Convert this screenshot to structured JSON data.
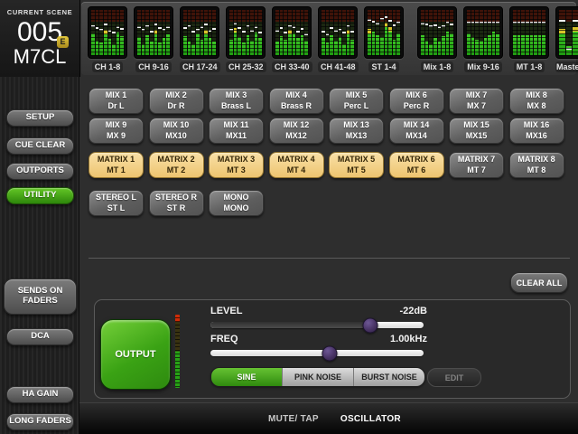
{
  "scene": {
    "label": "CURRENT SCENE",
    "number": "005",
    "badge": "E",
    "name": "M7CL"
  },
  "meter_bridge": {
    "blocks": [
      {
        "label": "CH 1-8",
        "levels": [
          48,
          32,
          28,
          56,
          36,
          24,
          50,
          42
        ],
        "peaks": [
          62,
          58,
          55,
          66,
          52,
          48,
          60,
          57
        ]
      },
      {
        "label": "CH 9-16",
        "levels": [
          40,
          25,
          45,
          30,
          57,
          28,
          38,
          46
        ],
        "peaks": [
          60,
          55,
          63,
          50,
          66,
          58,
          54,
          61
        ]
      },
      {
        "label": "CH 17-24",
        "levels": [
          42,
          30,
          25,
          48,
          35,
          56,
          38,
          30
        ],
        "peaks": [
          58,
          62,
          50,
          55,
          60,
          66,
          52,
          57
        ]
      },
      {
        "label": "CH 25-32",
        "levels": [
          35,
          60,
          40,
          28,
          45,
          32,
          50,
          38
        ],
        "peaks": [
          55,
          68,
          58,
          50,
          62,
          52,
          60,
          48
        ]
      },
      {
        "label": "CH 33-40",
        "levels": [
          30,
          42,
          35,
          56,
          48,
          38,
          44,
          32
        ],
        "peaks": [
          52,
          58,
          48,
          62,
          60,
          50,
          56,
          45
        ]
      },
      {
        "label": "CH 41-48",
        "levels": [
          38,
          28,
          45,
          33,
          40,
          25,
          56,
          35
        ],
        "peaks": [
          50,
          45,
          58,
          52,
          55,
          48,
          63,
          50
        ]
      },
      {
        "label": "ST 1-4",
        "levels": [
          58,
          52,
          45,
          40,
          72,
          62,
          35,
          48
        ],
        "peaks": [
          76,
          72,
          68,
          78,
          82,
          74,
          65,
          70
        ]
      },
      {
        "label": "Mix 1-8",
        "levels": [
          45,
          32,
          25,
          38,
          30,
          42,
          52,
          48
        ],
        "peaks": [
          68,
          66,
          62,
          64,
          60,
          63,
          71,
          67
        ],
        "gap_before": true
      },
      {
        "label": "Mix 9-16",
        "levels": [
          48,
          40,
          35,
          32,
          38,
          44,
          52,
          46
        ],
        "peaks": [
          71,
          71,
          71,
          71,
          71,
          71,
          71,
          71
        ]
      },
      {
        "label": "MT 1-8",
        "levels": [
          45,
          45,
          44,
          45,
          45,
          44,
          45,
          45
        ],
        "peaks": [
          71,
          71,
          71,
          71,
          71,
          71,
          71,
          71
        ]
      },
      {
        "label": "Master",
        "levels": [
          58,
          20,
          62
        ],
        "peaks": [
          74,
          12,
          74
        ],
        "narrow": true
      }
    ]
  },
  "sidebar": {
    "buttons": [
      {
        "id": "setup",
        "lines": [
          "SETUP"
        ],
        "variant": "gray"
      },
      {
        "id": "cue-clear",
        "lines": [
          "CUE CLEAR"
        ],
        "variant": "gray"
      },
      {
        "id": "outports",
        "lines": [
          "OUTPORTS"
        ],
        "variant": "gray"
      },
      {
        "id": "utility",
        "lines": [
          "UTILITY"
        ],
        "variant": "green"
      },
      {
        "id": "sends-on-faders",
        "lines": [
          "SENDS ON",
          "FADERS"
        ],
        "variant": "gray"
      },
      {
        "id": "dca",
        "lines": [
          "DCA"
        ],
        "variant": "gray"
      },
      {
        "id": "ha-gain",
        "lines": [
          "HA GAIN"
        ],
        "variant": "gray"
      },
      {
        "id": "long-faders",
        "lines": [
          "LONG FADERS"
        ],
        "variant": "gray"
      }
    ]
  },
  "bus_grid": {
    "rows": [
      {
        "buttons": [
          {
            "line1": "MIX 1",
            "line2": "Dr L",
            "active": false
          },
          {
            "line1": "MIX 2",
            "line2": "Dr R",
            "active": false
          },
          {
            "line1": "MIX 3",
            "line2": "Brass L",
            "active": false
          },
          {
            "line1": "MIX 4",
            "line2": "Brass R",
            "active": false
          },
          {
            "line1": "MIX 5",
            "line2": "Perc L",
            "active": false
          },
          {
            "line1": "MIX 6",
            "line2": "Perc R",
            "active": false
          },
          {
            "line1": "MIX 7",
            "line2": "MX 7",
            "active": false
          },
          {
            "line1": "MIX 8",
            "line2": "MX 8",
            "active": false
          }
        ]
      },
      {
        "buttons": [
          {
            "line1": "MIX 9",
            "line2": "MX 9",
            "active": false
          },
          {
            "line1": "MIX 10",
            "line2": "MX10",
            "active": false
          },
          {
            "line1": "MIX 11",
            "line2": "MX11",
            "active": false
          },
          {
            "line1": "MIX 12",
            "line2": "MX12",
            "active": false
          },
          {
            "line1": "MIX 13",
            "line2": "MX13",
            "active": false
          },
          {
            "line1": "MIX 14",
            "line2": "MX14",
            "active": false
          },
          {
            "line1": "MIX 15",
            "line2": "MX15",
            "active": false
          },
          {
            "line1": "MIX 16",
            "line2": "MX16",
            "active": false
          }
        ]
      },
      {
        "buttons": [
          {
            "line1": "MATRIX 1",
            "line2": "MT 1",
            "active": true
          },
          {
            "line1": "MATRIX 2",
            "line2": "MT 2",
            "active": true
          },
          {
            "line1": "MATRIX 3",
            "line2": "MT 3",
            "active": true
          },
          {
            "line1": "MATRIX 4",
            "line2": "MT 4",
            "active": true
          },
          {
            "line1": "MATRIX 5",
            "line2": "MT 5",
            "active": true
          },
          {
            "line1": "MATRIX 6",
            "line2": "MT 6",
            "active": true
          },
          {
            "line1": "MATRIX 7",
            "line2": "MT 7",
            "active": false
          },
          {
            "line1": "MATRIX 8",
            "line2": "MT 8",
            "active": false
          }
        ]
      },
      {
        "buttons": [
          {
            "line1": "STEREO L",
            "line2": "ST L",
            "active": false
          },
          {
            "line1": "STEREO R",
            "line2": "ST R",
            "active": false
          },
          {
            "line1": "MONO",
            "line2": "MONO",
            "active": false
          }
        ]
      }
    ]
  },
  "main": {
    "clear_all_label": "CLEAR ALL"
  },
  "oscillator": {
    "output_label": "OUTPUT",
    "level": {
      "label": "LEVEL",
      "value": "-22dB",
      "percent": 75
    },
    "freq": {
      "label": "FREQ",
      "value": "1.00kHz",
      "percent": 56
    },
    "waveforms": [
      {
        "label": "SINE",
        "active": true
      },
      {
        "label": "PINK NOISE",
        "active": false
      },
      {
        "label": "BURST NOISE",
        "active": false
      }
    ],
    "edit_label": "EDIT"
  },
  "bottom_bar": {
    "tabs": [
      {
        "label": "MUTE/ TAP",
        "active": false
      },
      {
        "label": "OSCILLATOR",
        "active": true
      }
    ]
  },
  "colors": {
    "accent_green": "#3fa012",
    "selected_tan": "#f2cf8e",
    "meter_green": "#33c41e",
    "meter_yellow": "#d9c52a",
    "slider_handle": "#483364"
  }
}
